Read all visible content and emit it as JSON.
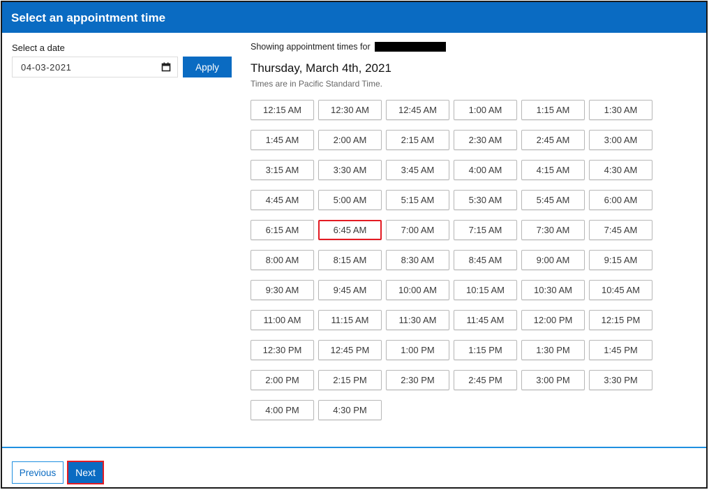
{
  "header": {
    "title": "Select an appointment time"
  },
  "date_picker": {
    "label": "Select a date",
    "value": "04-03-2021",
    "icon": "calendar-icon",
    "apply_label": "Apply"
  },
  "schedule": {
    "showing_text": "Showing appointment times for",
    "date_heading": "Thursday, March 4th, 2021",
    "timezone_note": "Times are in Pacific Standard Time.",
    "selected_slot": "6:45 AM",
    "slots": [
      "12:15 AM",
      "12:30 AM",
      "12:45 AM",
      "1:00 AM",
      "1:15 AM",
      "1:30 AM",
      "1:45 AM",
      "2:00 AM",
      "2:15 AM",
      "2:30 AM",
      "2:45 AM",
      "3:00 AM",
      "3:15 AM",
      "3:30 AM",
      "3:45 AM",
      "4:00 AM",
      "4:15 AM",
      "4:30 AM",
      "4:45 AM",
      "5:00 AM",
      "5:15 AM",
      "5:30 AM",
      "5:45 AM",
      "6:00 AM",
      "6:15 AM",
      "6:45 AM",
      "7:00 AM",
      "7:15 AM",
      "7:30 AM",
      "7:45 AM",
      "8:00 AM",
      "8:15 AM",
      "8:30 AM",
      "8:45 AM",
      "9:00 AM",
      "9:15 AM",
      "9:30 AM",
      "9:45 AM",
      "10:00 AM",
      "10:15 AM",
      "10:30 AM",
      "10:45 AM",
      "11:00 AM",
      "11:15 AM",
      "11:30 AM",
      "11:45 AM",
      "12:00 PM",
      "12:15 PM",
      "12:30 PM",
      "12:45 PM",
      "1:00 PM",
      "1:15 PM",
      "1:30 PM",
      "1:45 PM",
      "2:00 PM",
      "2:15 PM",
      "2:30 PM",
      "2:45 PM",
      "3:00 PM",
      "3:30 PM",
      "4:00 PM",
      "4:30 PM"
    ]
  },
  "footer": {
    "previous_label": "Previous",
    "next_label": "Next"
  },
  "colors": {
    "primary": "#0a6bc2",
    "highlight": "#e31b23",
    "rule": "#1f8fe0"
  }
}
